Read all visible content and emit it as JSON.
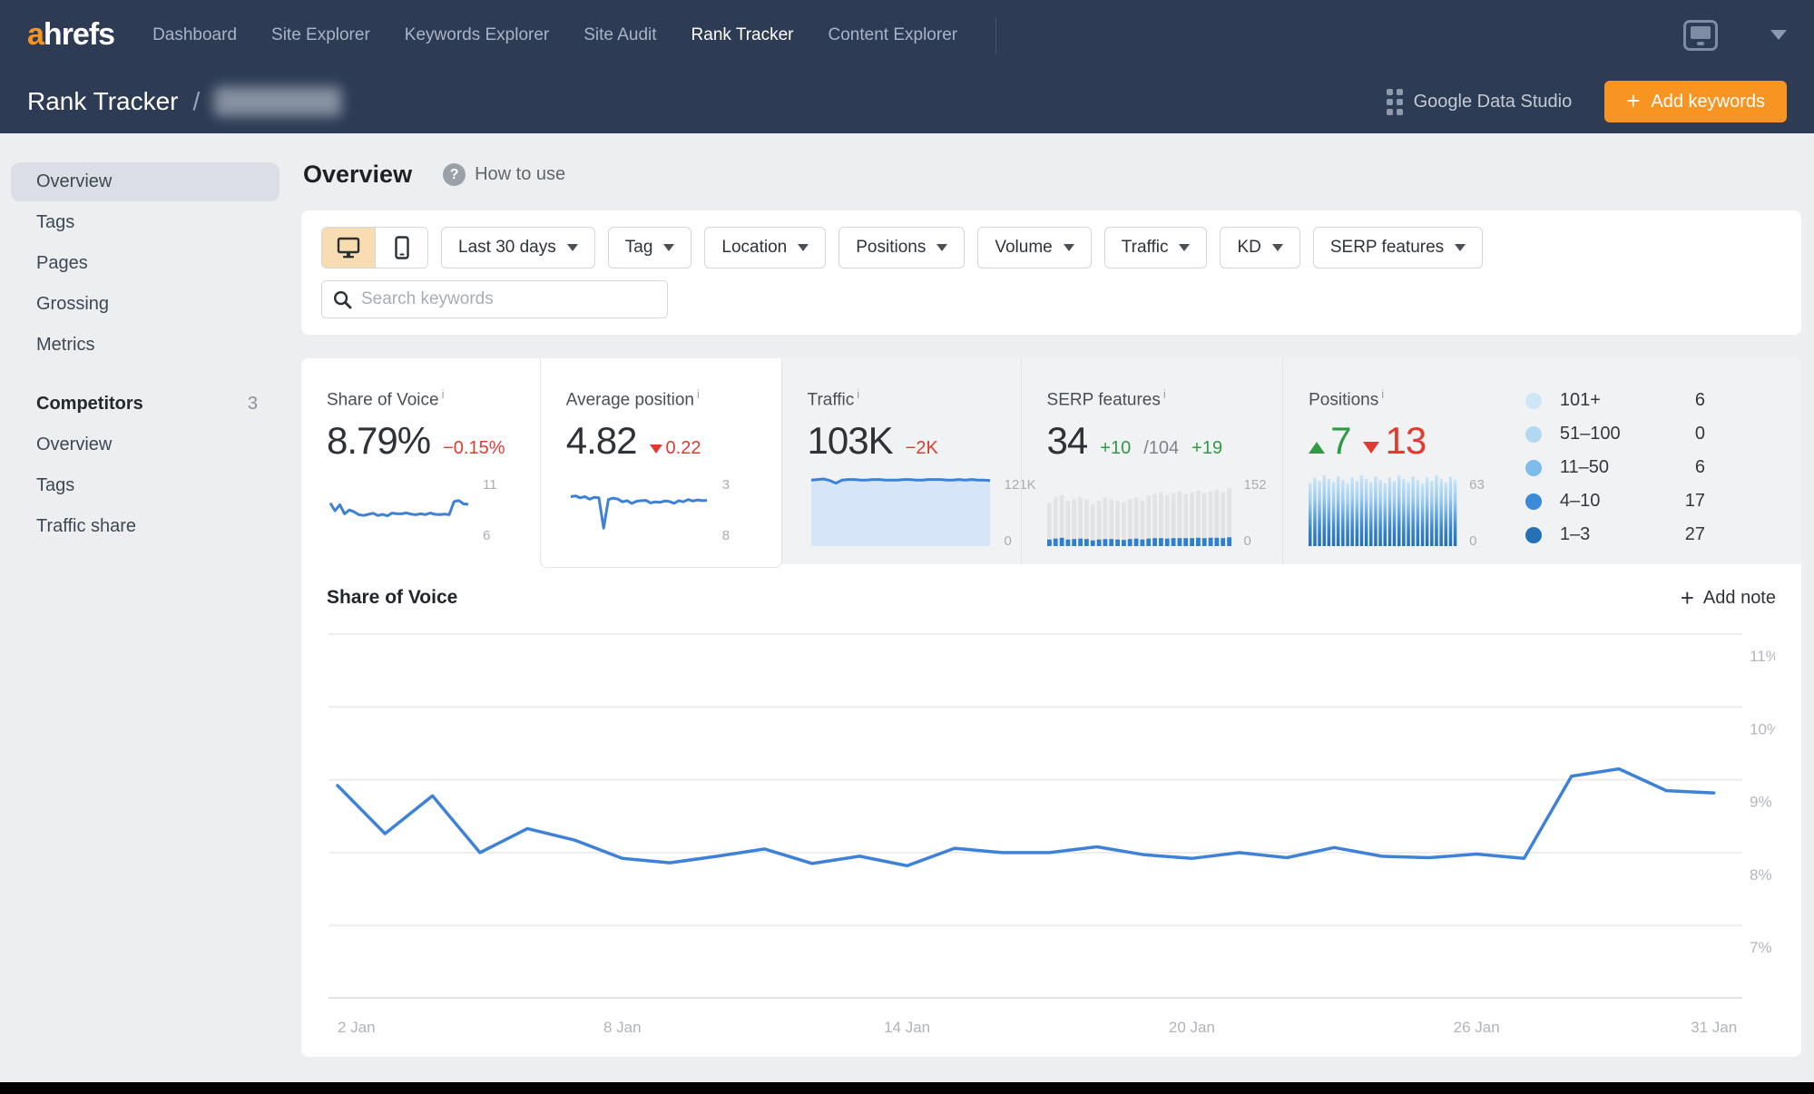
{
  "nav": {
    "logo_accent": "a",
    "logo_rest": "hrefs",
    "items": [
      {
        "label": "Dashboard",
        "active": false
      },
      {
        "label": "Site Explorer",
        "active": false
      },
      {
        "label": "Keywords Explorer",
        "active": false
      },
      {
        "label": "Site Audit",
        "active": false
      },
      {
        "label": "Rank Tracker",
        "active": true
      },
      {
        "label": "Content Explorer",
        "active": false
      }
    ]
  },
  "header": {
    "title": "Rank Tracker",
    "separator": "/",
    "gds_label": "Google Data Studio",
    "add_keywords_label": "Add keywords",
    "add_keywords_plus": "+"
  },
  "sidebar": {
    "items": [
      {
        "label": "Overview",
        "active": true
      },
      {
        "label": "Tags",
        "active": false
      },
      {
        "label": "Pages",
        "active": false
      },
      {
        "label": "Grossing",
        "active": false
      },
      {
        "label": "Metrics",
        "active": false
      }
    ],
    "competitors": {
      "label": "Competitors",
      "count": "3",
      "items": [
        {
          "label": "Overview"
        },
        {
          "label": "Tags"
        },
        {
          "label": "Traffic share"
        }
      ]
    }
  },
  "page": {
    "title": "Overview",
    "help_icon_glyph": "?",
    "help_label": "How to use"
  },
  "filters": {
    "dropdowns": [
      {
        "label": "Last 30 days"
      },
      {
        "label": "Tag"
      },
      {
        "label": "Location"
      },
      {
        "label": "Positions"
      },
      {
        "label": "Volume"
      },
      {
        "label": "Traffic"
      },
      {
        "label": "KD"
      },
      {
        "label": "SERP features"
      }
    ],
    "search_placeholder": "Search keywords"
  },
  "metrics": {
    "info_glyph": "i",
    "share_of_voice": {
      "title": "Share of Voice",
      "value": "8.79%",
      "delta": "−0.15%",
      "axis_top": "11",
      "axis_bottom": "6"
    },
    "average_position": {
      "title": "Average position",
      "value": "4.82",
      "delta": "0.22",
      "axis_top": "3",
      "axis_bottom": "8"
    },
    "traffic": {
      "title": "Traffic",
      "value": "103K",
      "delta": "−2K",
      "axis_top": "121K",
      "axis_bottom": "0"
    },
    "serp_features": {
      "title": "SERP features",
      "value": "34",
      "delta": "+10",
      "total": "/104",
      "total_delta": "+19",
      "axis_top": "152",
      "axis_bottom": "0"
    },
    "positions": {
      "title": "Positions",
      "up_value": "7",
      "down_value": "13",
      "axis_top": "63",
      "axis_bottom": "0"
    },
    "legend": [
      {
        "label": "101+",
        "count": "6",
        "color": "#cfe6f7"
      },
      {
        "label": "51–100",
        "count": "0",
        "color": "#b3d8f2"
      },
      {
        "label": "11–50",
        "count": "6",
        "color": "#7cbdec"
      },
      {
        "label": "4–10",
        "count": "17",
        "color": "#3a8ad9"
      },
      {
        "label": "1–3",
        "count": "27",
        "color": "#2571b5"
      }
    ]
  },
  "chart": {
    "title": "Share of Voice",
    "add_note_plus": "+",
    "add_note_label": "Add note"
  },
  "chart_data": {
    "type": "line",
    "title": "Share of Voice",
    "line_color": "#3e82d7",
    "grid": true,
    "legend_position": "none",
    "x_unit": "day of January",
    "x": [
      2,
      3,
      4,
      5,
      6,
      7,
      8,
      9,
      10,
      11,
      12,
      13,
      14,
      15,
      16,
      17,
      18,
      19,
      20,
      21,
      22,
      23,
      24,
      25,
      26,
      27,
      28,
      29,
      30,
      31
    ],
    "values": [
      8.92,
      8.26,
      8.78,
      8.0,
      8.33,
      8.17,
      7.92,
      7.86,
      7.95,
      8.05,
      7.85,
      7.95,
      7.82,
      8.06,
      8.0,
      8.0,
      8.08,
      7.97,
      7.92,
      8.0,
      7.93,
      8.07,
      7.95,
      7.93,
      7.98,
      7.92,
      9.05,
      9.15,
      8.85,
      8.82
    ],
    "ylim": [
      6.5,
      11.5
    ],
    "yticks": [
      11,
      10,
      9,
      8,
      7
    ],
    "ytick_suffix": "%",
    "xticks": [
      {
        "label": "2 Jan",
        "day": 2
      },
      {
        "label": "8 Jan",
        "day": 8
      },
      {
        "label": "14 Jan",
        "day": 14
      },
      {
        "label": "20 Jan",
        "day": 20
      },
      {
        "label": "26 Jan",
        "day": 26
      },
      {
        "label": "31 Jan",
        "day": 31
      }
    ],
    "sparklines": {
      "share_of_voice": {
        "type": "line",
        "range": [
          6,
          11
        ],
        "values": [
          8.92,
          8.26,
          8.78,
          8.0,
          8.33,
          8.17,
          7.92,
          7.86,
          7.95,
          8.05,
          7.85,
          7.95,
          7.82,
          8.06,
          8.0,
          8.0,
          8.08,
          7.97,
          7.92,
          8.0,
          7.93,
          8.07,
          7.95,
          7.93,
          7.98,
          7.92,
          9.05,
          9.15,
          8.85,
          8.82
        ]
      },
      "average_position": {
        "type": "line",
        "range": [
          3,
          8
        ],
        "inverted": true,
        "values": [
          4.5,
          4.42,
          4.6,
          4.48,
          4.72,
          4.55,
          4.6,
          7.3,
          4.75,
          4.62,
          4.7,
          4.95,
          4.85,
          5.1,
          4.9,
          4.85,
          4.82,
          5.05,
          4.95,
          5.0,
          4.88,
          4.92,
          5.08,
          4.85,
          4.95,
          4.75,
          4.88,
          4.78,
          4.85,
          4.82
        ]
      },
      "traffic": {
        "type": "area",
        "range": [
          0,
          121
        ],
        "values": [
          119,
          120,
          121,
          118,
          113,
          119,
          120,
          120,
          119,
          119,
          120,
          120,
          119,
          119,
          119,
          120,
          120,
          119,
          119,
          120,
          120,
          120,
          119,
          119,
          120,
          119,
          120,
          119,
          119,
          118
        ]
      },
      "serp_features": {
        "type": "stacked-bar",
        "range": [
          0,
          152
        ],
        "totals": [
          98,
          110,
          116,
          102,
          106,
          110,
          106,
          95,
          102,
          110,
          106,
          102,
          99,
          106,
          110,
          103,
          114,
          118,
          122,
          116,
          120,
          124,
          118,
          122,
          126,
          120,
          124,
          128,
          122,
          133
        ],
        "featured": [
          15,
          17,
          19,
          15,
          16,
          17,
          16,
          13,
          15,
          16,
          16,
          15,
          14,
          16,
          17,
          15,
          17,
          18,
          18,
          17,
          18,
          18,
          18,
          18,
          19,
          18,
          19,
          19,
          18,
          20
        ]
      },
      "positions": {
        "type": "stripe-bar",
        "range": [
          0,
          63
        ],
        "values": [
          56,
          61,
          58,
          63,
          60,
          57,
          62,
          59,
          56,
          61,
          58,
          63,
          60,
          57,
          62,
          59,
          56,
          61,
          58,
          63,
          60,
          57,
          62,
          59,
          56,
          61,
          58,
          63,
          60,
          57,
          62,
          59
        ]
      }
    }
  }
}
